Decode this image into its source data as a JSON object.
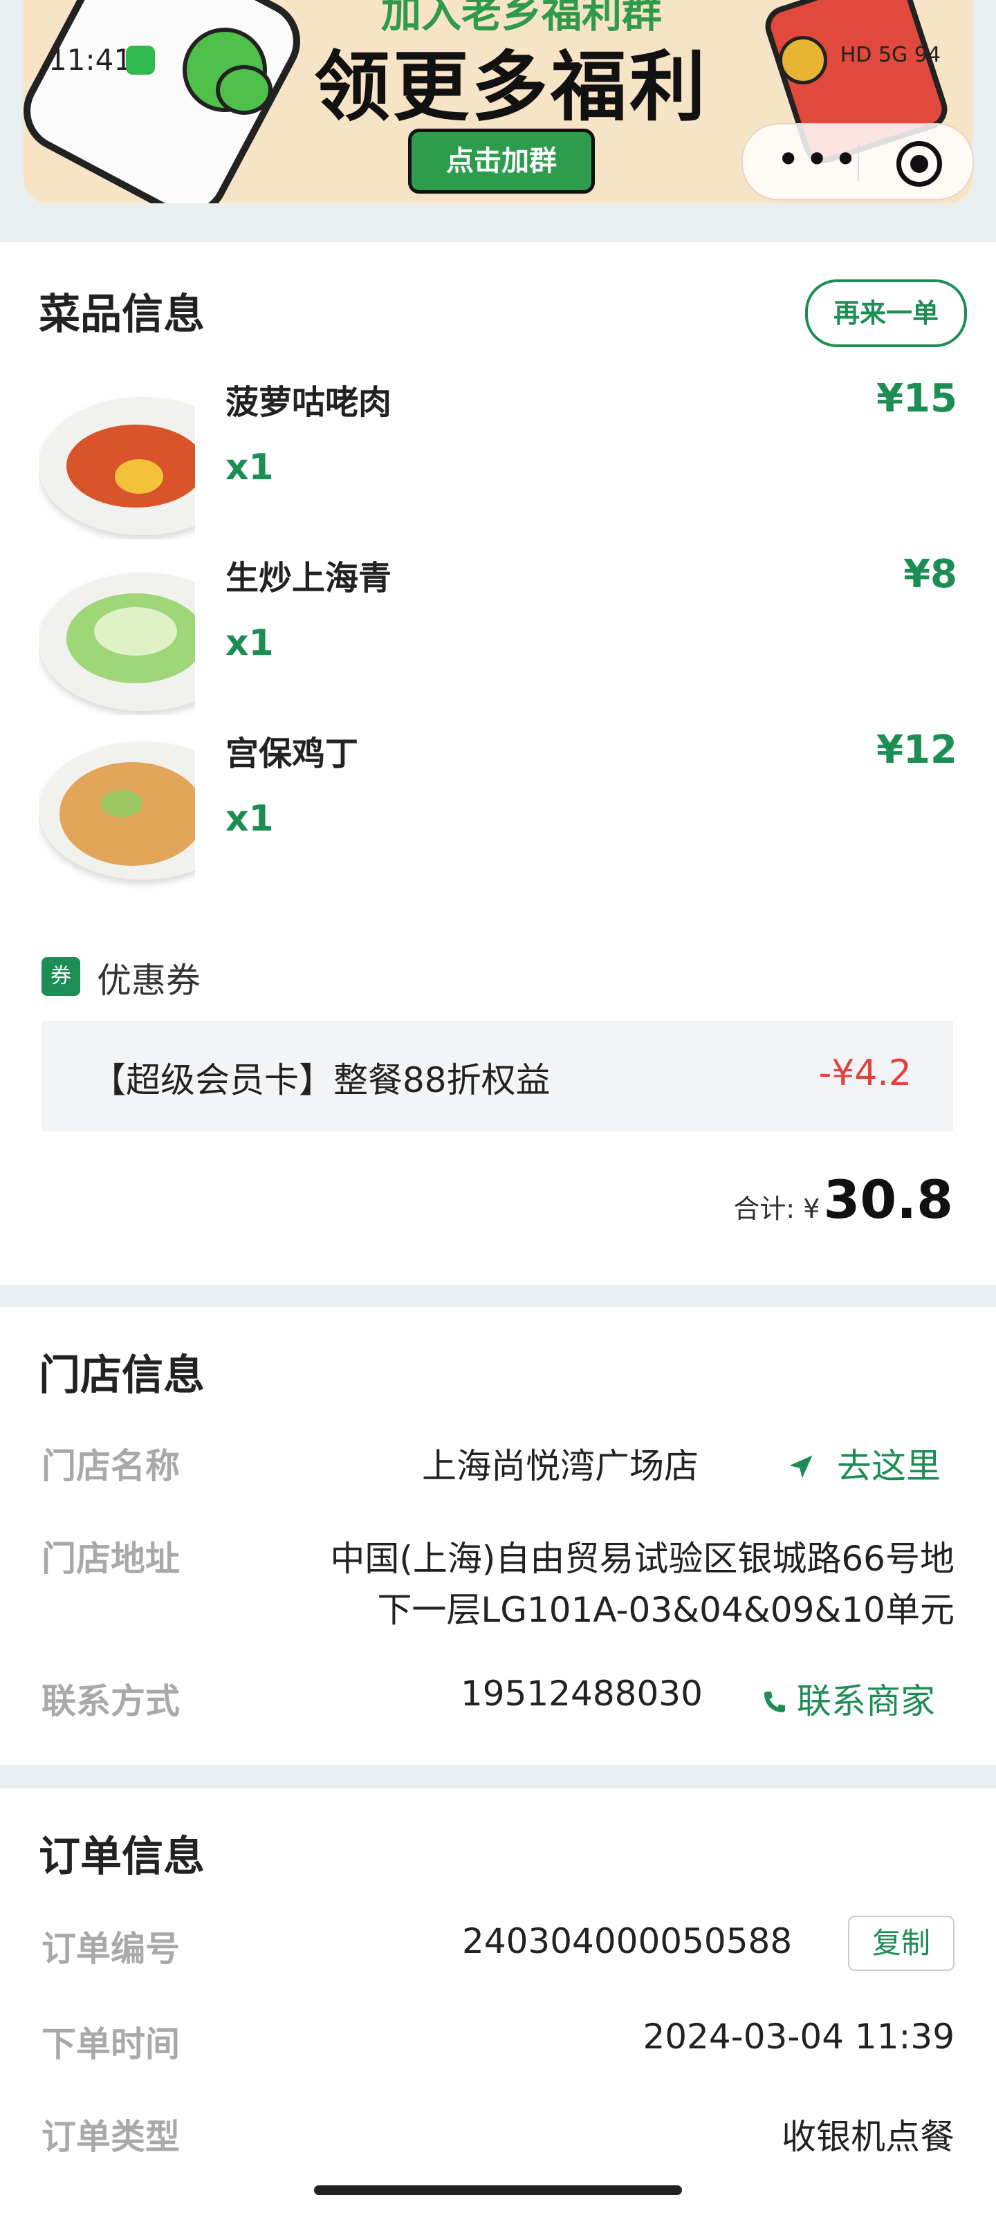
{
  "status_bar": {
    "time": "11:41",
    "right_text": "HD 5G 94"
  },
  "banner": {
    "title_top": "加入老乡福利群",
    "title_main": "领更多福利",
    "join_label": "点击加群"
  },
  "dishes": {
    "title": "菜品信息",
    "reorder_label": "再来一单",
    "items": [
      {
        "name": "菠萝咕咾肉",
        "qty": "x1",
        "price": "¥15"
      },
      {
        "name": "生炒上海青",
        "qty": "x1",
        "price": "¥8"
      },
      {
        "name": "宫保鸡丁",
        "qty": "x1",
        "price": "¥12"
      }
    ],
    "coupon_tag": "券",
    "coupon_label": "优惠券",
    "coupon_desc": "【超级会员卡】整餐88折权益",
    "coupon_amount": "-¥4.2",
    "total_label": "合计: ¥",
    "total_value": "30.8"
  },
  "store": {
    "title": "门店信息",
    "name_key": "门店名称",
    "name_value": "上海尚悦湾广场店",
    "nav_label": "去这里",
    "address_key": "门店地址",
    "address_line1": "中国(上海)自由贸易试验区银城路66号地",
    "address_line2": "下一层LG101A-03&04&09&10单元",
    "contact_key": "联系方式",
    "contact_value": "19512488030",
    "contact_label": "联系商家"
  },
  "order": {
    "title": "订单信息",
    "number_key": "订单编号",
    "number_value": "240304000050588",
    "copy_label": "复制",
    "time_key": "下单时间",
    "time_value": "2024-03-04 11:39",
    "type_key": "订单类型",
    "type_value": "收银机点餐"
  },
  "colors": {
    "accent": "#1c8d53",
    "discount": "#e0423d"
  }
}
